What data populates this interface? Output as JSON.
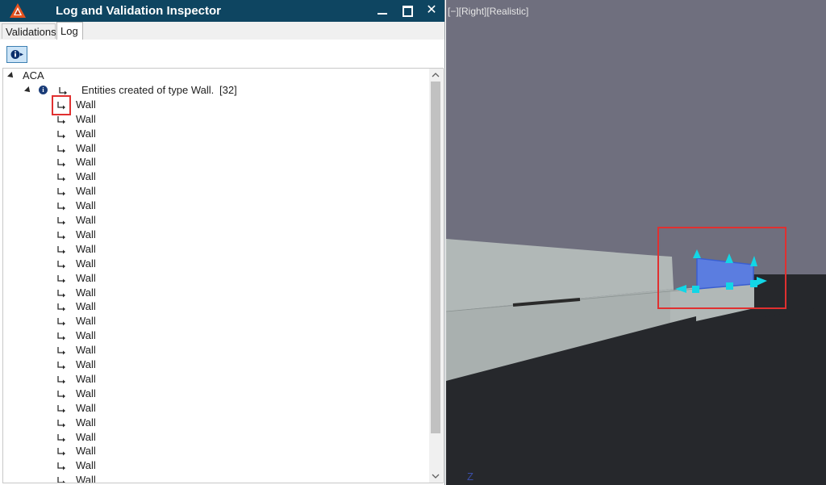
{
  "window": {
    "title": "Log and Validation Inspector",
    "buttons": {
      "minimize": "",
      "maximize": "",
      "close": "✕"
    }
  },
  "tabs": [
    {
      "label": "Validations",
      "active": false
    },
    {
      "label": "Log",
      "active": true
    }
  ],
  "toolbar": {
    "info_filter_icon": "info-icon",
    "info_filter_active": true
  },
  "tree": {
    "root": {
      "label": "ACA",
      "expanded": true
    },
    "group": {
      "label": "Entities created of type Wall.",
      "count": "[32]",
      "icon": "info-icon",
      "expanded": true
    },
    "items": [
      {
        "label": "Wall"
      },
      {
        "label": "Wall"
      },
      {
        "label": "Wall"
      },
      {
        "label": "Wall"
      },
      {
        "label": "Wall"
      },
      {
        "label": "Wall"
      },
      {
        "label": "Wall"
      },
      {
        "label": "Wall"
      },
      {
        "label": "Wall"
      },
      {
        "label": "Wall"
      },
      {
        "label": "Wall"
      },
      {
        "label": "Wall"
      },
      {
        "label": "Wall"
      },
      {
        "label": "Wall"
      },
      {
        "label": "Wall"
      },
      {
        "label": "Wall"
      },
      {
        "label": "Wall"
      },
      {
        "label": "Wall"
      },
      {
        "label": "Wall"
      },
      {
        "label": "Wall"
      },
      {
        "label": "Wall"
      },
      {
        "label": "Wall"
      },
      {
        "label": "Wall"
      },
      {
        "label": "Wall"
      },
      {
        "label": "Wall"
      },
      {
        "label": "Wall"
      }
    ],
    "partial_item": "Wall"
  },
  "viewport": {
    "label": "[−][Right][Realistic]",
    "axis_label": "Z",
    "colors": {
      "sky": "#6f6f7e",
      "ground": "#26282c",
      "wall": "#b1b8b7",
      "selection": "#5b7de0",
      "grip": "#12d6e6",
      "highlight": "#e03030"
    }
  }
}
